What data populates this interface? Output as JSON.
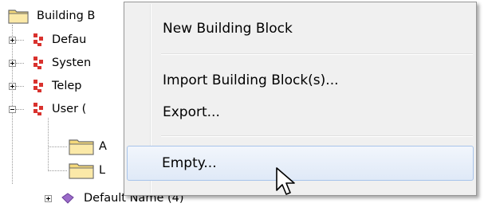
{
  "tree": {
    "root_label": "Building B",
    "items": [
      {
        "label": "Defau"
      },
      {
        "label": "Systen"
      },
      {
        "label": "Telep"
      },
      {
        "label": "User ("
      }
    ],
    "children": [
      {
        "label": "A"
      },
      {
        "label": "L"
      }
    ],
    "bottom_item": {
      "label": "Default Name (4)"
    }
  },
  "context_menu": {
    "items": [
      {
        "label": "New Building Block"
      },
      {
        "label": "Import Building Block(s)..."
      },
      {
        "label": "Export..."
      },
      {
        "label": "Empty...",
        "hovered": true
      }
    ]
  },
  "icons": {
    "folder": "folder-icon",
    "building_block": "building-block-icon",
    "mouse_cursor": "mouse-pointer-icon"
  },
  "colors": {
    "menu_background": "#f0f0f0",
    "hover_border": "#a8c4ea",
    "folder_yellow": "#f5d97a",
    "block_red": "#d9322e"
  }
}
